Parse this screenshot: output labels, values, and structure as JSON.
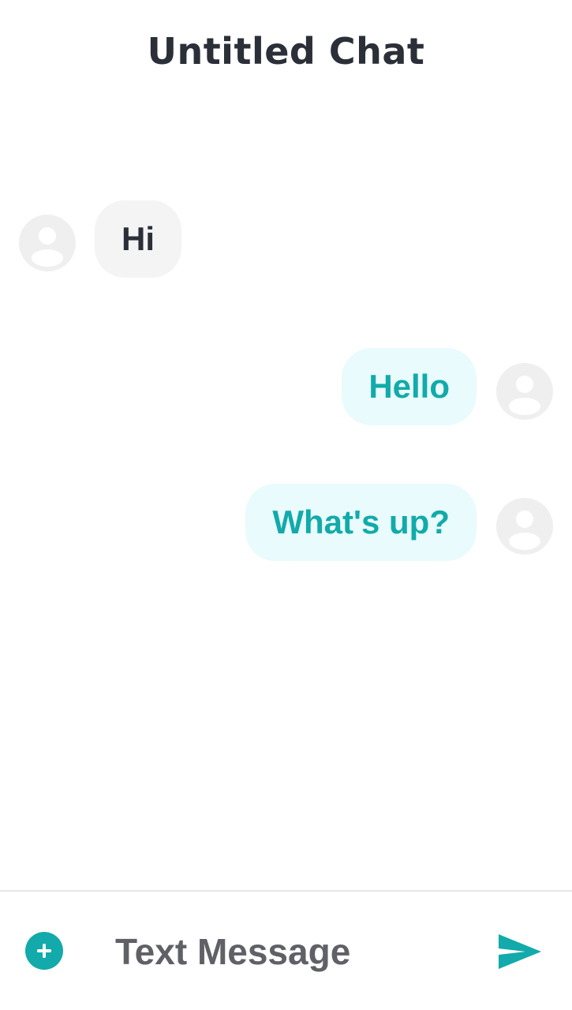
{
  "header": {
    "title": "Untitled Chat"
  },
  "messages": [
    {
      "direction": "incoming",
      "text": "Hi",
      "avatar_icon": "user-avatar-icon"
    },
    {
      "direction": "outgoing",
      "text": "Hello",
      "avatar_icon": "user-avatar-icon"
    },
    {
      "direction": "outgoing",
      "text": "What's up?",
      "avatar_icon": "user-avatar-icon"
    }
  ],
  "composer": {
    "placeholder": "Text Message",
    "value": "",
    "add_icon": "plus-circle-icon",
    "send_icon": "send-icon"
  },
  "colors": {
    "accent": "#12aaaa",
    "incoming_bubble": "#f4f4f5",
    "outgoing_bubble": "#e9fbfc",
    "avatar_bg": "#efefef",
    "title_text": "#2b2f38"
  }
}
